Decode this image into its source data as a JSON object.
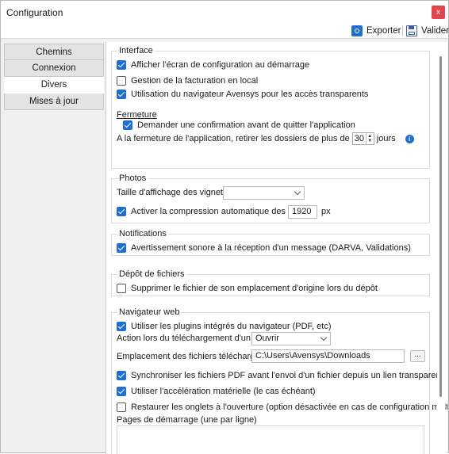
{
  "window": {
    "title": "Configuration",
    "close_label": "x"
  },
  "toolbar": {
    "export_label": "Exporter",
    "validate_label": "Valider"
  },
  "nav": {
    "items": [
      {
        "label": "Chemins",
        "active": false
      },
      {
        "label": "Connexion",
        "active": false
      },
      {
        "label": "Divers",
        "active": true
      },
      {
        "label": "Mises à jour",
        "active": false
      }
    ]
  },
  "interface": {
    "title": "Interface",
    "show_config_on_start": {
      "label": "Afficher l'écran de configuration au démarrage",
      "checked": true
    },
    "billing_local": {
      "label": "Gestion de la facturation en local",
      "checked": false
    },
    "avensys_browser": {
      "label": "Utilisation du navigateur Avensys pour les accès transparents",
      "checked": true
    },
    "closing_title": "Fermeture",
    "confirm_quit": {
      "label": "Demander une confirmation avant de quitter l'application",
      "checked": true
    },
    "remove_folders_prefix": "A la fermeture de l'application, retirer les dossiers de plus de",
    "remove_folders_days": "30",
    "remove_folders_suffix": "jours",
    "info_icon": "i"
  },
  "photos": {
    "title": "Photos",
    "thumb_size_label": "Taille d'affichage des vignettes",
    "thumb_size_value": "",
    "compress": {
      "label": "Activer la compression automatique des photos",
      "checked": true
    },
    "compress_px": "1920",
    "px_unit": "px"
  },
  "notifications": {
    "title": "Notifications",
    "sound": {
      "label": "Avertissement sonore à la réception d'un message (DARVA, Validations)",
      "checked": true
    }
  },
  "deposit": {
    "title": "Dépôt de fichiers",
    "delete_original": {
      "label": "Supprimer le fichier de son emplacement d'origine lors du dépôt",
      "checked": false
    }
  },
  "web": {
    "title": "Navigateur web",
    "plugins": {
      "label": "Utiliser les plugins intégrés du navigateur (PDF, etc)",
      "checked": true
    },
    "download_action_label": "Action lors du téléchargement d'un fichier",
    "download_action_value": "Ouvrir",
    "download_location_label": "Emplacement des fichiers téléchargés",
    "download_location_value": "C:\\Users\\Avensys\\Downloads",
    "browse_label": "...",
    "sync_pdf": {
      "label": "Synchroniser les fichiers PDF avant l'envoi d'un fichier depuis un lien transparent",
      "checked": true
    },
    "hw_accel": {
      "label": "Utiliser l'accélération matérielle (le cas échéant)",
      "checked": true
    },
    "restore_tabs": {
      "label": "Restaurer les onglets à l'ouverture (option désactivée en cas de configuration multiple)",
      "checked": false
    },
    "start_pages_label": "Pages de démarrage (une par ligne)"
  },
  "colors": {
    "accent": "#1e6fd1",
    "close": "#e0454b"
  }
}
